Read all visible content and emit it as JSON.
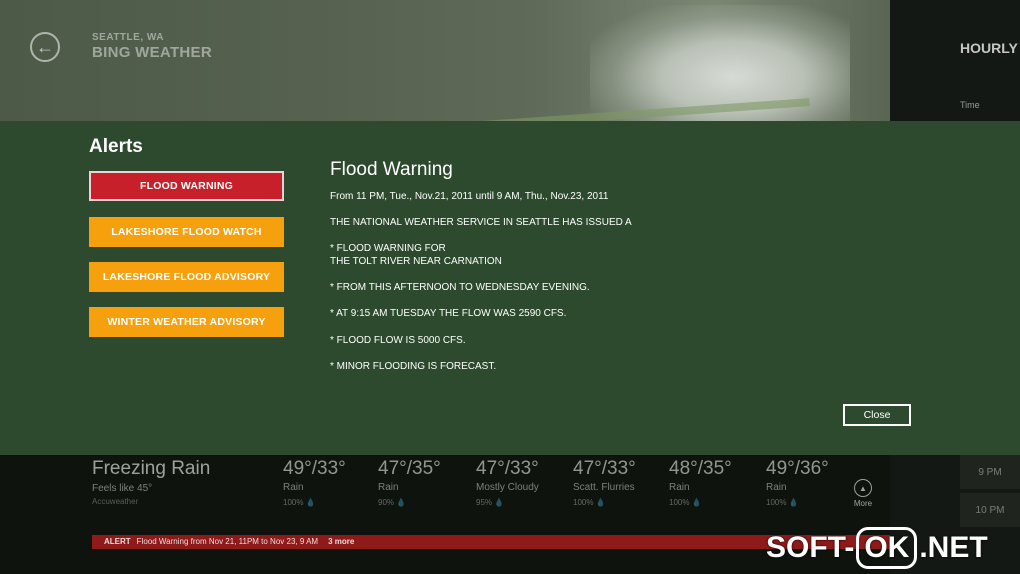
{
  "header": {
    "location": "SEATTLE, WA",
    "app_name": "BING WEATHER"
  },
  "right_panel": {
    "title": "HOURLY",
    "time_label": "Time",
    "hours": [
      "9 PM",
      "10 PM"
    ]
  },
  "current": {
    "condition": "Freezing Rain",
    "feels_like": "Feels like 45°",
    "source": "Accuweather"
  },
  "forecast": [
    {
      "temps": "49°/33°",
      "desc": "Rain",
      "precip": "100% 💧"
    },
    {
      "temps": "47°/35°",
      "desc": "Rain",
      "precip": "90% 💧"
    },
    {
      "temps": "47°/33°",
      "desc": "Mostly Cloudy",
      "precip": "95% 💧"
    },
    {
      "temps": "47°/33°",
      "desc": "Scatt. Flurries",
      "precip": "100% 💧"
    },
    {
      "temps": "48°/35°",
      "desc": "Rain",
      "precip": "100% 💧"
    },
    {
      "temps": "49°/36°",
      "desc": "Rain",
      "precip": "100% 💧"
    }
  ],
  "more_label": "More",
  "alert_bar": {
    "tag": "ALERT",
    "text": "Flood Warning from Nov 21, 11PM to Nov 23, 9 AM",
    "count": "3 more"
  },
  "alerts_panel": {
    "heading": "Alerts",
    "items": [
      {
        "label": "FLOOD WARNING",
        "selected": true
      },
      {
        "label": "LAKESHORE FLOOD WATCH",
        "selected": false
      },
      {
        "label": "LAKESHORE FLOOD ADVISORY",
        "selected": false
      },
      {
        "label": "WINTER WEATHER ADVISORY",
        "selected": false
      }
    ],
    "detail": {
      "title": "Flood Warning",
      "period": "From 11 PM, Tue., Nov.21, 2011 until 9 AM, Thu., Nov.23, 2011",
      "lines": [
        "THE NATIONAL WEATHER SERVICE IN SEATTLE HAS ISSUED A",
        "* FLOOD WARNING FOR",
        "THE TOLT RIVER NEAR CARNATION",
        "* FROM THIS AFTERNOON TO WEDNESDAY EVENING.",
        "* AT 9:15 AM TUESDAY THE FLOW WAS 2590 CFS.",
        "* FLOOD FLOW IS 5000 CFS.",
        "* MINOR FLOODING IS FORECAST."
      ]
    },
    "close_label": "Close"
  },
  "watermark": {
    "left": "SOFT-",
    "mid": "OK",
    "right": ".NET"
  },
  "colors": {
    "flyout_bg": "#2d4a2e",
    "selected_alert": "#c8202a",
    "warning_alert": "#f5a00c",
    "alert_bar": "#8e1a1a"
  }
}
